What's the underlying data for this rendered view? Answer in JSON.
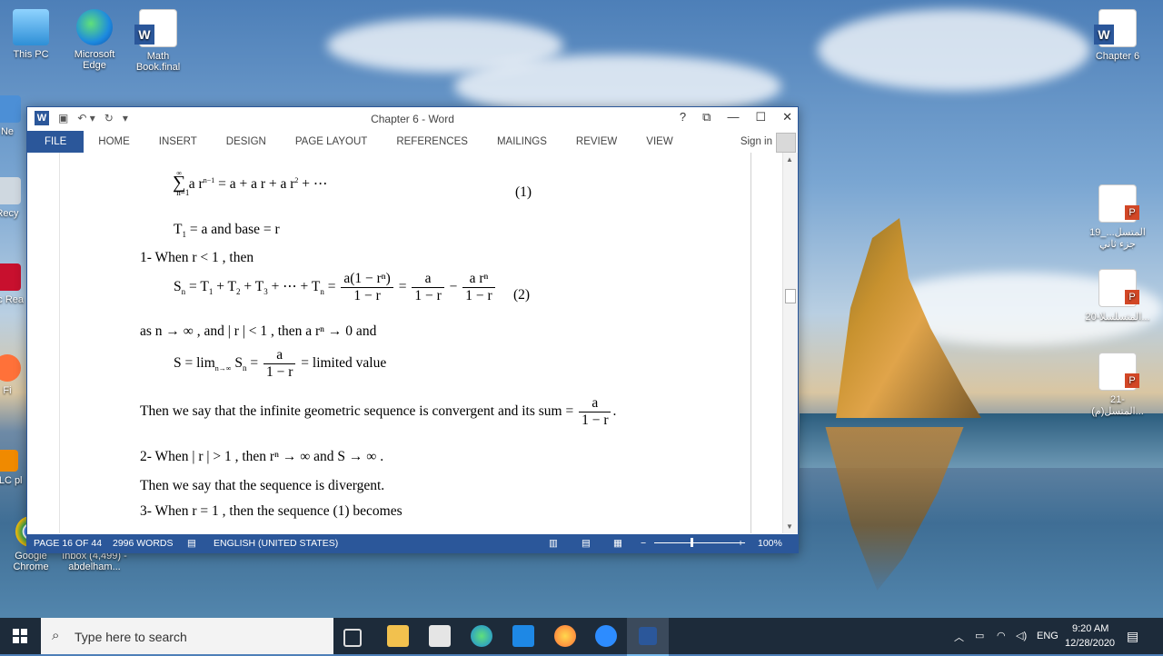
{
  "desktop": {
    "icons_left": [
      {
        "label": "This PC",
        "icon": "computer-icon"
      },
      {
        "label": "Microsoft Edge",
        "icon": "edge-icon"
      },
      {
        "label": "Math Book.final",
        "icon": "word-doc-icon"
      }
    ],
    "partial_icons": [
      "Ne",
      "Recy",
      "Ac Rea",
      "Fi",
      "VLC pl"
    ],
    "icons_bottom": [
      {
        "label": "Google Chrome",
        "icon": "chrome-icon"
      },
      {
        "label": "Inbox (4,499) - abdelham...",
        "icon": "mail-icon"
      }
    ],
    "icons_right": [
      {
        "label": "Chapter 6",
        "icon": "word-doc-icon"
      },
      {
        "label": "19_المتسل... جزء ثاني",
        "icon": "powerpoint-icon"
      },
      {
        "label": "20-المتسلسلا...",
        "icon": "powerpoint-icon"
      },
      {
        "label": "21-(م)المتسل...",
        "icon": "powerpoint-icon"
      }
    ]
  },
  "word": {
    "title": "Chapter 6 - Word",
    "title_buttons": [
      "?",
      "⧉",
      "—",
      "☐",
      "✕"
    ],
    "tabs": [
      "FILE",
      "HOME",
      "INSERT",
      "DESIGN",
      "PAGE LAYOUT",
      "REFERENCES",
      "MAILINGS",
      "REVIEW",
      "VIEW"
    ],
    "sign_in": "Sign in",
    "status": {
      "page": "PAGE 16 OF 44",
      "words": "2996 WORDS",
      "language": "ENGLISH (UNITED STATES)",
      "zoom": "100%"
    },
    "document": {
      "eq1_label": "(1)",
      "t1_line": "T",
      "line_t1_rest": " = a  and base = r",
      "case1": "1- When r < 1 , then",
      "eq2_label": "(2)",
      "limit_line": "as n → ∞ , and | r | < 1 , then  a rⁿ → 0  and",
      "s_limit_rest": " = limited  value",
      "convergent": "Then we say that the infinite geometric sequence is convergent and its sum = ",
      "case2": "2- When | r | > 1 , then  rⁿ → ∞  and  S → ∞ .",
      "divergent": "Then we say that the sequence is divergent.",
      "case3": "3- When r = 1 , then the sequence (1) becomes"
    }
  },
  "taskbar": {
    "search_placeholder": "Type here to search",
    "time": "9:20 AM",
    "date": "12/28/2020",
    "lang": "ENG"
  }
}
